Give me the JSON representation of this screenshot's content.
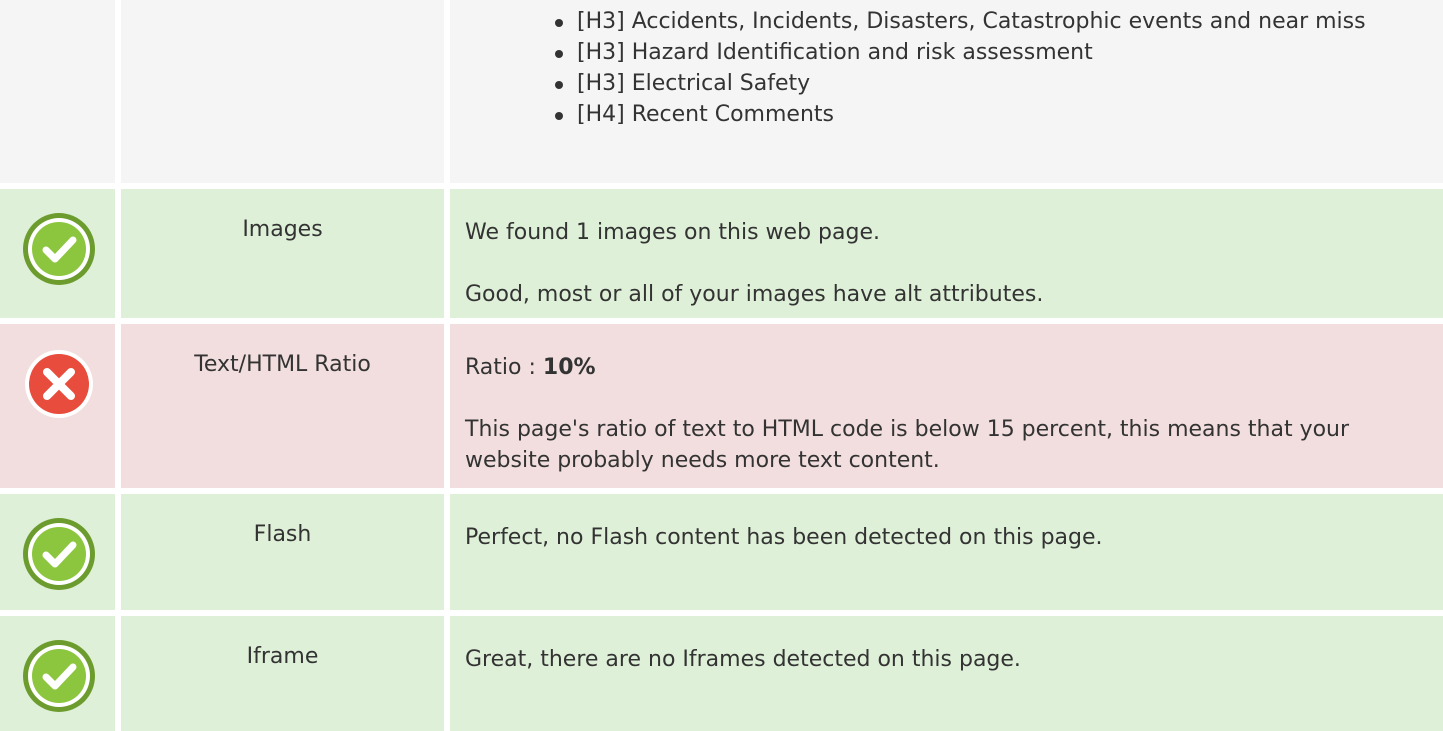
{
  "headings_row": {
    "items": [
      "[H3] Accidents, Incidents, Disasters, Catastrophic events and near miss",
      "[H3] Hazard Identification and risk assessment",
      "[H3] Electrical Safety",
      "[H4] Recent Comments"
    ]
  },
  "images_row": {
    "label": "Images",
    "line1": "We found 1 images on this web page.",
    "line2": "Good, most or all of your images have alt attributes.",
    "status_icon": "check-circle-icon"
  },
  "ratio_row": {
    "label": "Text/HTML Ratio",
    "ratio_prefix": "Ratio : ",
    "ratio_value": "10%",
    "message": "This page's ratio of text to HTML code is below 15 percent, this means that your website probably needs more text content.",
    "status_icon": "error-circle-icon"
  },
  "flash_row": {
    "label": "Flash",
    "message": "Perfect, no Flash content has been detected on this page.",
    "status_icon": "check-circle-icon"
  },
  "iframe_row": {
    "label": "Iframe",
    "message": "Great, there are no Iframes detected on this page.",
    "status_icon": "check-circle-icon"
  },
  "colors": {
    "ok_bg": "#dff0d8",
    "bad_bg": "#f2dede",
    "neutral_bg": "#f5f5f5",
    "ok_icon": "#8cc63f",
    "bad_icon": "#e74c3c"
  }
}
